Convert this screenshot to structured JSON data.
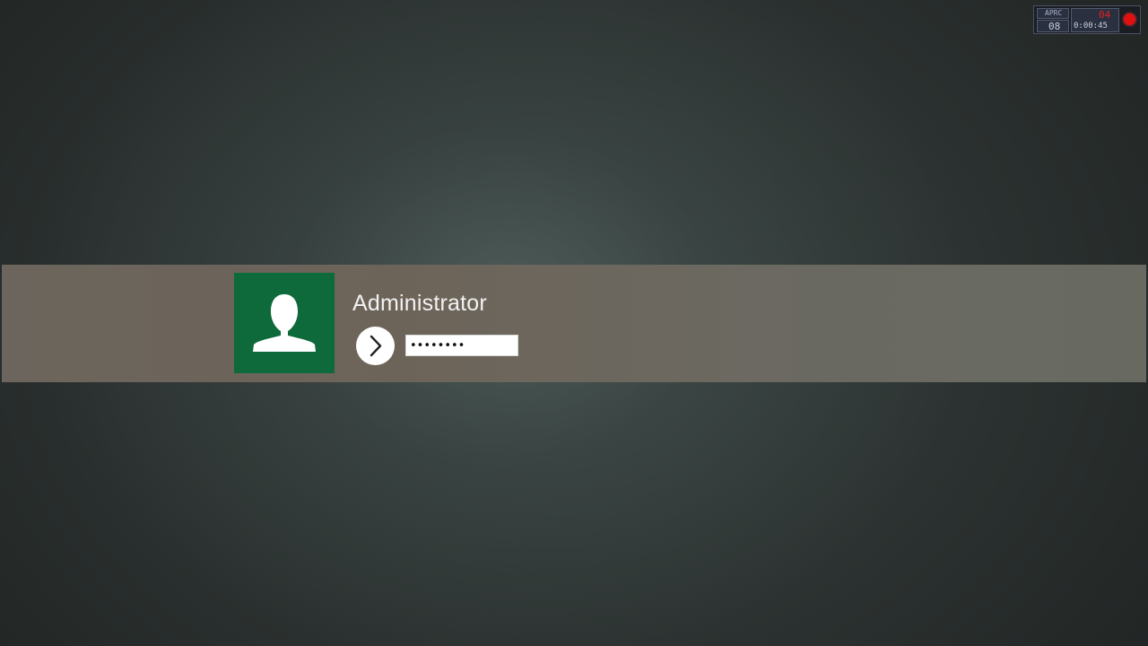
{
  "login": {
    "username": "Administrator",
    "password_value": "••••••••",
    "avatar_icon": "user-silhouette-icon",
    "submit_icon": "arrow-right-icon",
    "colors": {
      "avatar_bg": "#0e6a3b",
      "band_bg": "#6b655d"
    }
  },
  "recorder_overlay": {
    "label_small": "APRC",
    "counter": "08",
    "fps": "04",
    "elapsed": "0:00:45",
    "record_icon": "record-dot-icon"
  }
}
